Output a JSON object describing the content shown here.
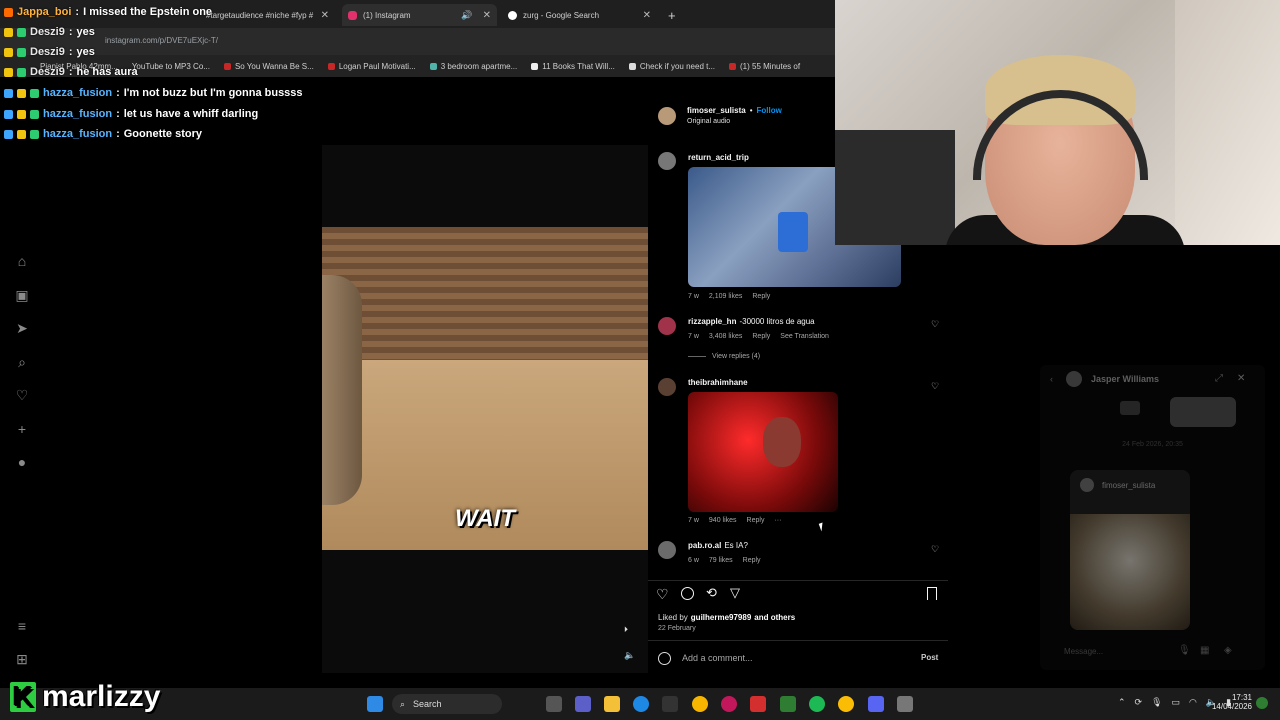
{
  "browser": {
    "tabs": [
      {
        "label": "#targetaudience #niche #fyp #"
      },
      {
        "label": "(1) Instagram"
      },
      {
        "label": "zurg - Google Search"
      }
    ],
    "url": "instagram.com/p/DVE7uEXjc-T/",
    "bookmarks": [
      "Pianist Pablo 42mm...",
      "YouTube to MP3 Co...",
      "So You Wanna Be S...",
      "Logan Paul Motivati...",
      "3 bedroom apartme...",
      "11 Books That Will...",
      "Check if you need t...",
      "(1) 55 Minutes of"
    ]
  },
  "chat": [
    {
      "user": "Jappa_boi",
      "message": "I missed the Epstein one"
    },
    {
      "user": "Deszi9",
      "message": "yes"
    },
    {
      "user": "Deszi9",
      "message": "yes"
    },
    {
      "user": "Deszi9",
      "message": "he has aura"
    },
    {
      "user": "hazza_fusion",
      "message": "I'm not buzz but I'm gonna bussss"
    },
    {
      "user": "hazza_fusion",
      "message": "let us have a whiff darling"
    },
    {
      "user": "hazza_fusion",
      "message": "Goonette story"
    }
  ],
  "chat_sep": ":",
  "video": {
    "caption": "WAIT"
  },
  "post": {
    "author": "fimoser_sulista",
    "follow": "Follow",
    "audio": "Original audio",
    "dot": "•",
    "comments": [
      {
        "user": "return_acid_trip",
        "text": "",
        "time": "7 w",
        "likes": "2,109 likes",
        "reply": "Reply"
      },
      {
        "user": "rizzapple_hn",
        "text": "-30000 litros de agua",
        "time": "7 w",
        "likes": "3,408 likes",
        "reply": "Reply",
        "translate": "See Translation",
        "view_replies": "View replies (4)"
      },
      {
        "user": "theibrahimhane",
        "text": "",
        "time": "7 w",
        "likes": "940 likes",
        "reply": "Reply",
        "more": "···"
      },
      {
        "user": "pab.ro.al",
        "text": "Es IA?",
        "time": "6 w",
        "likes": "79 likes",
        "reply": "Reply"
      }
    ],
    "liked_by_prefix": "Liked by",
    "liked_by_user": "guilherme97989",
    "liked_by_suffix": "and others",
    "date": "22 February",
    "add_comment": "Add a comment...",
    "post_button": "Post"
  },
  "dm": {
    "name": "Jasper Williams",
    "date": "24 Feb 2026, 20:35",
    "shared_user": "fimoser_sulista",
    "message_placeholder": "Message..."
  },
  "overlay": {
    "logo_k": "K",
    "logo_text": "marlizzy"
  },
  "taskbar": {
    "search": "Search",
    "time": "17:31",
    "date": "14/04/2026"
  }
}
